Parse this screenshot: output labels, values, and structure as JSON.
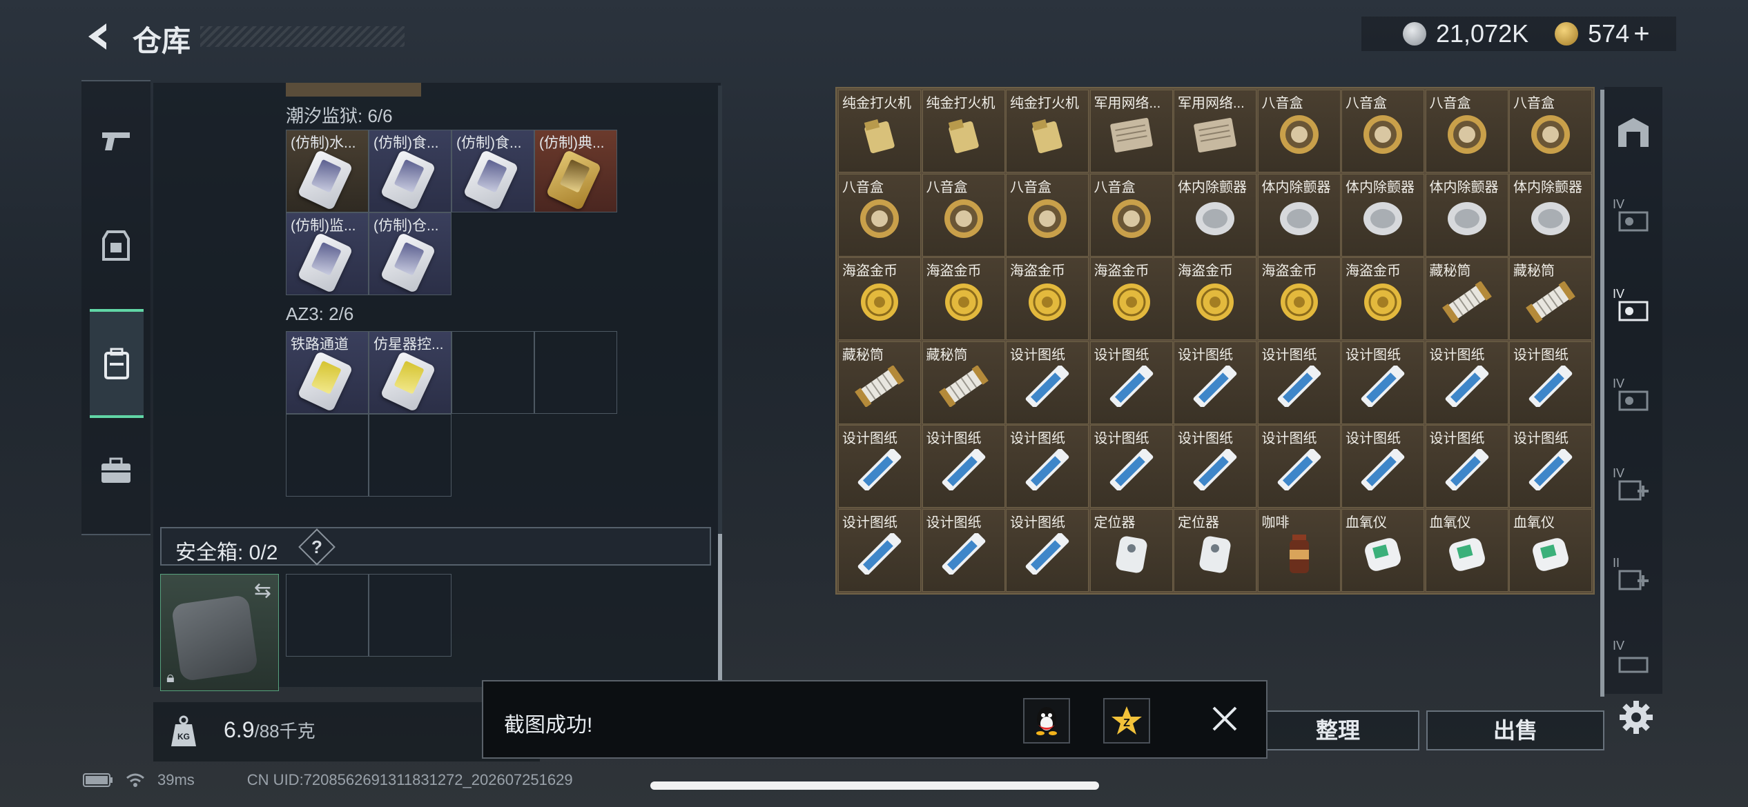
{
  "header": {
    "title": "仓库",
    "silver_amount": "21,072K",
    "gold_amount": "574",
    "gold_plus": "+"
  },
  "left_nav": {
    "icons": [
      "pistol-icon",
      "armor-icon",
      "backpack-icon",
      "case-icon"
    ],
    "active_index": 2
  },
  "left_panel": {
    "groups": [
      {
        "title": "潮汐监狱: 6/6",
        "items": [
          "(仿制)水...",
          "(仿制)食...",
          "(仿制)食...",
          "(仿制)典...",
          "(仿制)监...",
          "(仿制)仓..."
        ]
      },
      {
        "title": "AZ3: 2/6",
        "items": [
          "铁路通道",
          "仿星器控..."
        ]
      }
    ],
    "safe_box": {
      "label": "安全箱: 0/2",
      "help": "?"
    },
    "weight": {
      "current": "6.9",
      "max": "/88千克"
    }
  },
  "stash_grid": {
    "rows": [
      [
        "纯金打火机",
        "纯金打火机",
        "纯金打火机",
        "军用网络...",
        "军用网络...",
        "八音盒",
        "八音盒",
        "八音盒",
        "八音盒"
      ],
      [
        "八音盒",
        "八音盒",
        "八音盒",
        "八音盒",
        "体内除颤器",
        "体内除颤器",
        "体内除颤器",
        "体内除颤器",
        "体内除颤器"
      ],
      [
        "海盗金币",
        "海盗金币",
        "海盗金币",
        "海盗金币",
        "海盗金币",
        "海盗金币",
        "海盗金币",
        "藏秘筒",
        "藏秘筒"
      ],
      [
        "藏秘筒",
        "藏秘筒",
        "设计图纸",
        "设计图纸",
        "设计图纸",
        "设计图纸",
        "设计图纸",
        "设计图纸",
        "设计图纸"
      ],
      [
        "设计图纸",
        "设计图纸",
        "设计图纸",
        "设计图纸",
        "设计图纸",
        "设计图纸",
        "设计图纸",
        "设计图纸",
        "设计图纸"
      ],
      [
        "设计图纸",
        "设计图纸",
        "设计图纸",
        "定位器",
        "定位器",
        "咖啡",
        "血氧仪",
        "血氧仪",
        "血氧仪"
      ]
    ]
  },
  "right_nav": {
    "labels": [
      "",
      "IV",
      "IV",
      "IV",
      "IV",
      "II",
      "IV"
    ]
  },
  "actions": {
    "sort": "整理",
    "sell": "出售"
  },
  "toast": {
    "message": "截图成功!"
  },
  "status_bar": {
    "ping": "39ms",
    "uid": "CN UID:7208562691311831272_202607251629"
  }
}
